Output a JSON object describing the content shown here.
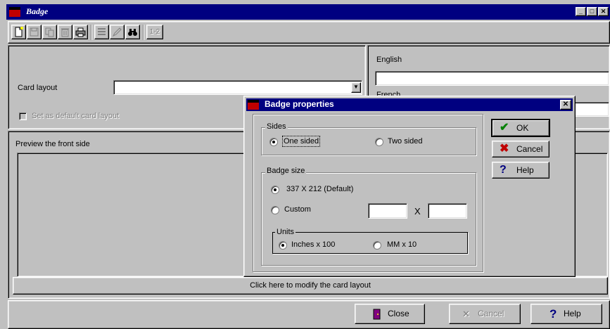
{
  "window": {
    "title": "Badge"
  },
  "title_buttons": {
    "minimize": "_",
    "maximize": "□",
    "close": "✕"
  },
  "toolbar": {
    "page_label": "1-2"
  },
  "left": {
    "card_layout_label": "Card layout",
    "card_layout_value": "",
    "default_layout_label": "Set as default card layout"
  },
  "right": {
    "english_label": "English",
    "english_value": "",
    "french_label": "French",
    "french_value": ""
  },
  "preview": {
    "label": "Preview the front side",
    "modify_text": "Click here to modify the card layout"
  },
  "bottom": {
    "close_label": "Close",
    "cancel_label": "Cancel",
    "help_label": "Help"
  },
  "dialog": {
    "title": "Badge properties",
    "sides": {
      "label": "Sides",
      "one": "One sided",
      "two": "Two sided",
      "selected": "One sided"
    },
    "size": {
      "label": "Badge size",
      "default": "337 X 212 (Default)",
      "custom": "Custom",
      "x_sep": "X",
      "width_value": "",
      "height_value": "",
      "selected": "337 X 212 (Default)"
    },
    "units": {
      "label": "Units",
      "inches": "Inches x 100",
      "mm": "MM x 10",
      "selected": "Inches x 100"
    },
    "ok_label": "OK",
    "cancel_label": "Cancel",
    "help_label": "Help"
  },
  "colors": {
    "title_bar": "#000080",
    "face": "#c0c0c0",
    "ok_check": "#008000",
    "cancel_x": "#c00000",
    "help_q": "#000080"
  }
}
